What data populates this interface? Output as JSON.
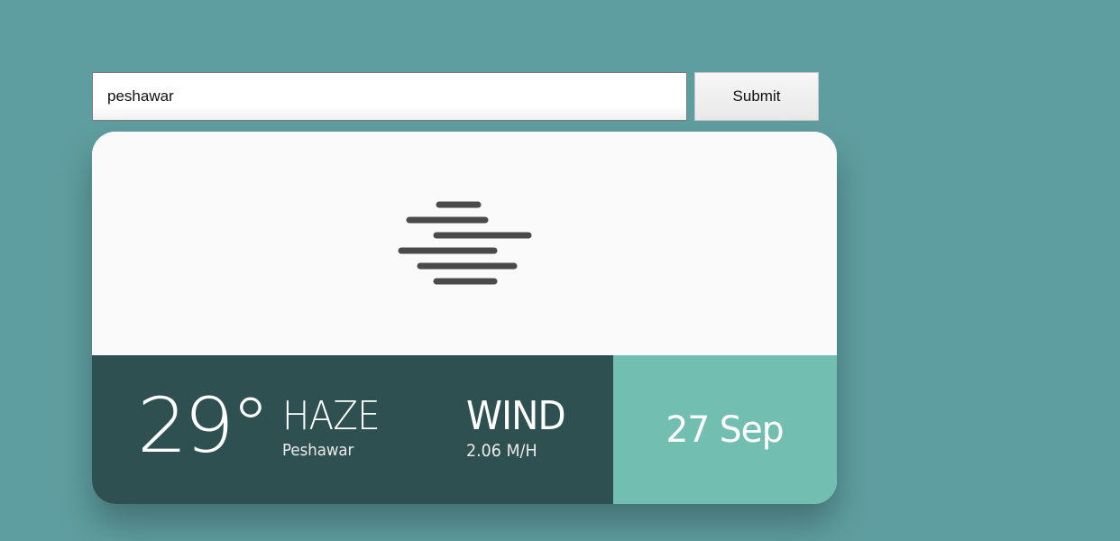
{
  "search": {
    "value": "peshawar",
    "submit_label": "Submit"
  },
  "weather": {
    "icon": "haze-icon",
    "temperature": "29°",
    "condition": "HAZE",
    "city": "Peshawar",
    "wind_label": "WIND",
    "wind_value": "2.06 M/H",
    "date": "27 Sep"
  },
  "colors": {
    "background": "#5f9ea0",
    "info_panel": "#2f5050",
    "date_panel": "#72bfb1",
    "icon": "#4a4a4a"
  }
}
